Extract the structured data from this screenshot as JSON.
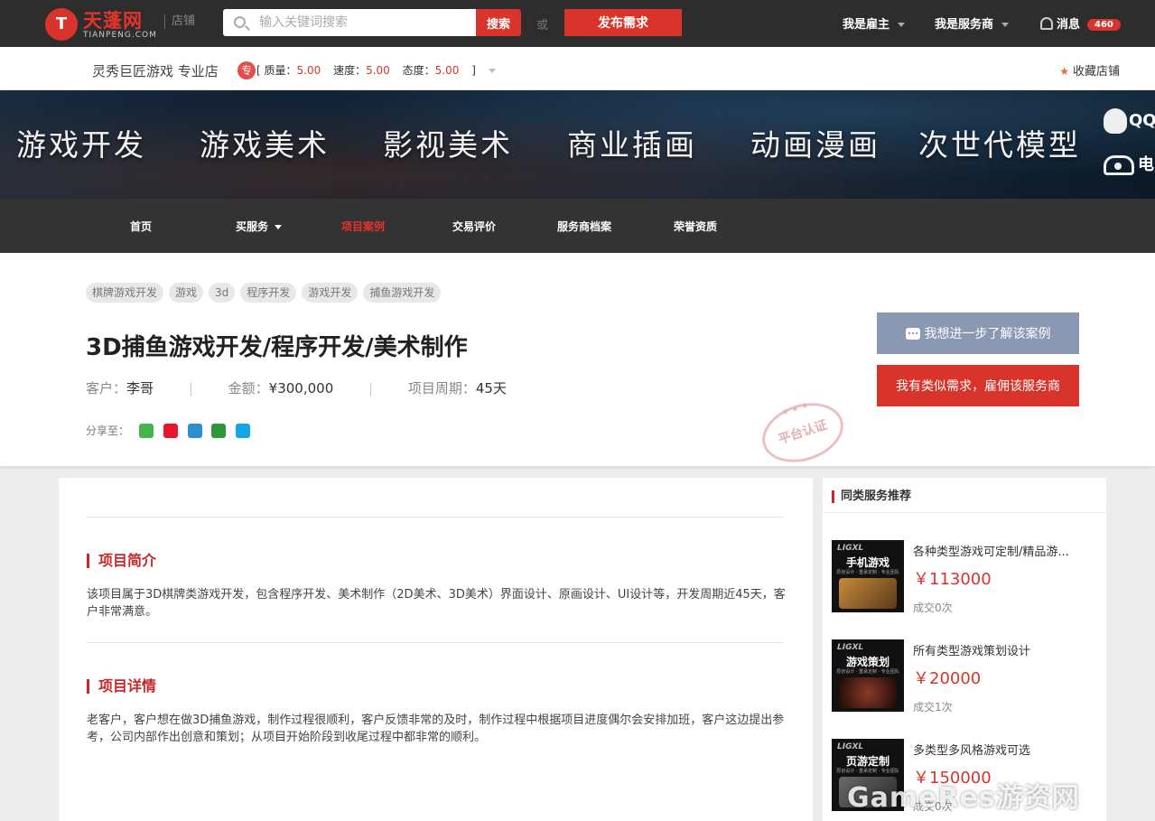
{
  "header": {
    "logo_cn": "天蓬网",
    "logo_en": "TIANPENG.COM",
    "logo_mark": "T",
    "store_tag": "店铺",
    "search_placeholder": "输入关键词搜索",
    "search_button": "搜索",
    "or_text": "或",
    "publish_button": "发布需求",
    "employer_link": "我是雇主",
    "provider_link": "我是服务商",
    "messages_label": "消息",
    "messages_count": "460"
  },
  "store": {
    "name": "灵秀巨匠游戏 专业店",
    "badge": "专",
    "open_bracket": "[",
    "close_bracket": "]",
    "quality_label": "质量：",
    "quality_value": "5.00",
    "speed_label": "速度：",
    "speed_value": "5.00",
    "attitude_label": "态度：",
    "attitude_value": "5.00",
    "favorite": "收藏店铺"
  },
  "banner": {
    "items": [
      "游戏开发",
      "游戏美术",
      "影视美术",
      "商业插画",
      "动画漫画",
      "次世代模型"
    ],
    "qq": "QQ",
    "phone": "电"
  },
  "nav": {
    "items": [
      "首页",
      "买服务",
      "项目案例",
      "交易评价",
      "服务商档案",
      "荣誉资质"
    ]
  },
  "case": {
    "tags": [
      "棋牌游戏开发",
      "游戏",
      "3d",
      "程序开发",
      "游戏开发",
      "捕鱼游戏开发"
    ],
    "title": "3D捕鱼游戏开发/程序开发/美术制作",
    "client_label": "客户：",
    "client_value": "李哥",
    "amount_label": "金额：",
    "amount_value": "¥300,000",
    "period_label": "项目周期：",
    "period_value": "45天",
    "divider": "|",
    "share_label": "分享至：",
    "stamp_text": "平台认证",
    "stamp_stars": "★ ★ ★",
    "learn_button": "我想进一步了解该案例",
    "hire_button": "我有类似需求，雇佣该服务商"
  },
  "sections": {
    "intro_title": "项目简介",
    "intro_text": "该项目属于3D棋牌类游戏开发，包含程序开发、美术制作（2D美术、3D美术）界面设计、原画设计、UI设计等，开发周期近45天，客户非常满意。",
    "detail_title": "项目详情",
    "detail_text": "老客户，客户想在做3D捕鱼游戏，制作过程很顺利，客户反馈非常的及时，制作过程中根据项目进度偶尔会安排加班，客户这边提出参考，公司内部作出创意和策划；从项目开始阶段到收尾过程中都非常的顺利。"
  },
  "sidebar": {
    "title": "同类服务推荐",
    "items": [
      {
        "name": "各种类型游戏可定制/精品游...",
        "price": "￥113000",
        "sold": "成交0次",
        "img_brand": "LIGXL",
        "img_word": "手机游戏",
        "img_sub": "原创设计 · 重承定制 · 专业团队",
        "accent": "#c98a3a"
      },
      {
        "name": "所有类型游戏策划设计",
        "price": "￥20000",
        "sold": "成交1次",
        "img_brand": "LIGXL",
        "img_word": "游戏策划",
        "img_sub": "原创设计 · 重承定制 · 专业团队",
        "accent": "#8a3a2a"
      },
      {
        "name": "多类型多风格游戏可选",
        "price": "￥150000",
        "sold": "成交0次",
        "img_brand": "LIGXL",
        "img_word": "页游定制",
        "img_sub": "原创设计 · 重承定制 · 专业团队",
        "accent": "#6a6a6a"
      }
    ]
  },
  "watermark": "GameRes游资网",
  "colors": {
    "brand_red": "#d9342b",
    "topbar": "#2d2d2d",
    "nav": "#333333",
    "learn_button": "#8b98b3"
  }
}
